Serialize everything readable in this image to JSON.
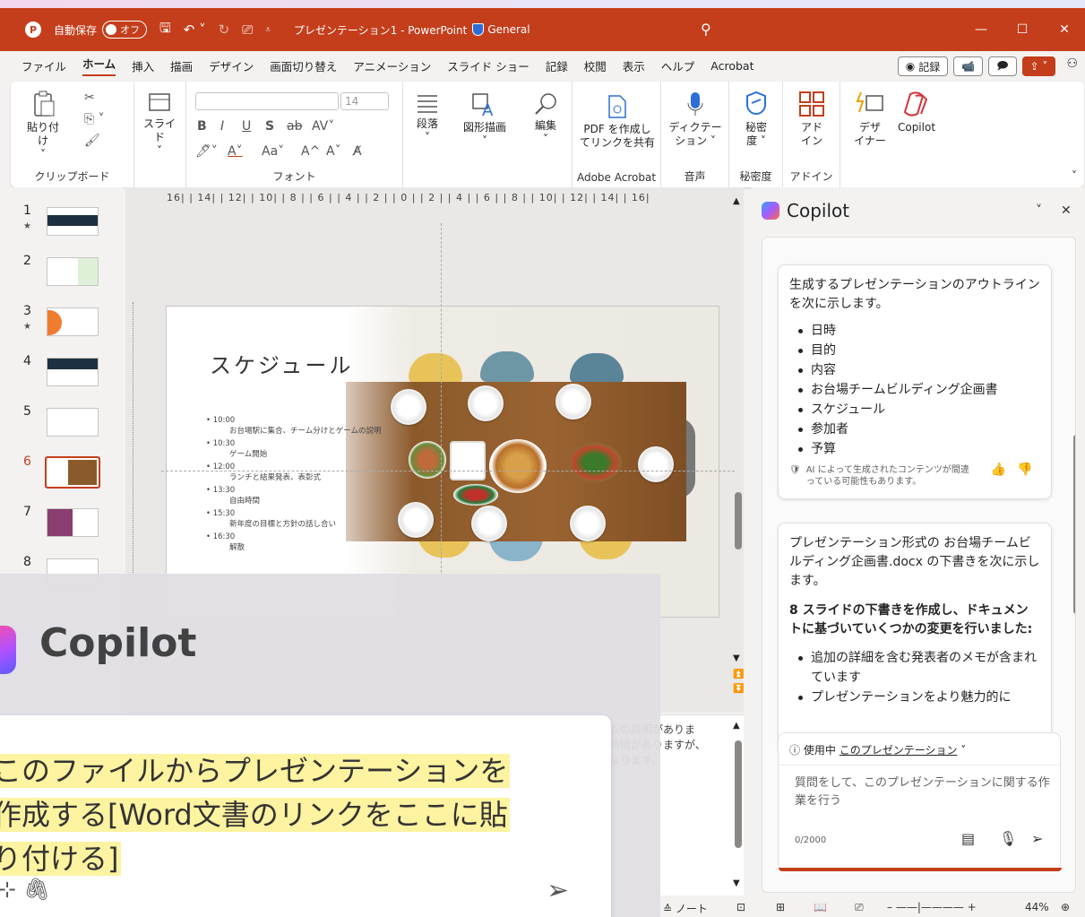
{
  "titlebar": {
    "autosave_label": "自動保存",
    "autosave_state": "オフ",
    "doc_title": "プレゼンテーション1 - PowerPoint",
    "sensitivity": "General",
    "minimize": "—",
    "maximize": "☐",
    "close": "✕"
  },
  "tabs": [
    "ファイル",
    "ホーム",
    "挿入",
    "描画",
    "デザイン",
    "画面切り替え",
    "アニメーション",
    "スライド ショー",
    "記録",
    "校閲",
    "表示",
    "ヘルプ",
    "Acrobat"
  ],
  "tabs_right": {
    "record": "記録"
  },
  "ribbon": {
    "paste": "貼り付け",
    "clipboard": "クリップボード",
    "slide": "スライド",
    "font_size": "14",
    "font_group": "フォント",
    "paragraph": "段落",
    "shapes": "図形描画",
    "edit": "編集",
    "pdf_line1": "PDF を作成し",
    "pdf_line2": "てリンクを共有",
    "adobe_group": "Adobe Acrobat",
    "dictate_line1": "ディクテー",
    "dictate_line2": "ション",
    "voice_group": "音声",
    "sens_line1": "秘密",
    "sens_line2": "度",
    "sens_group": "秘密度",
    "addin_line1": "アド",
    "addin_line2": "イン",
    "addin_group": "アドイン",
    "designer_line1": "デザ",
    "designer_line2": "イナー",
    "copilot": "Copilot"
  },
  "thumbs": [
    "1",
    "2",
    "3",
    "4",
    "5",
    "6",
    "7",
    "8"
  ],
  "ruler_text": "16| | 14| | 12| | 10| | 8 | | 6 | | 4 | | 2 | | 0 | | 2 | | 4 | | 6 | | 8 | | 10| | 12| | 14| | 16|",
  "slide": {
    "title": "スケジュール",
    "schedule": [
      {
        "time": "10:00",
        "desc": "お台場駅に集合、チーム分けとゲームの説明"
      },
      {
        "time": "10:30",
        "desc": "ゲーム開始"
      },
      {
        "time": "12:00",
        "desc": "ランチと結果発表、表彰式"
      },
      {
        "time": "13:30",
        "desc": "自由時間"
      },
      {
        "time": "15:30",
        "desc": "新年度の目標と方針の話し合い"
      },
      {
        "time": "16:30",
        "desc": "解散"
      }
    ]
  },
  "notes": {
    "line1": "ムの説明がありま",
    "line2": "時間がありますが、",
    "line3": "なります。"
  },
  "copilot": {
    "title": "Copilot",
    "card1": {
      "intro": "生成するプレゼンテーションのアウトラインを次に示します。",
      "items": [
        "日時",
        "目的",
        "内容",
        "お台場チームビルディング企画書",
        "スケジュール",
        "参加者",
        "予算"
      ],
      "disclaimer": "AI によって生成されたコンテンツが間違っている可能性もあります。"
    },
    "card2": {
      "intro": "プレゼンテーション形式の お台場チームビルディング企画書.docx の下書きを次に示します。",
      "bold": "8 スライドの下書きを作成し、ドキュメントに基づいていくつかの変更を行いました:",
      "items": [
        "追加の詳細を含む発表者のメモが含まれています",
        "プレゼンテーションをより魅力的に"
      ]
    },
    "context_prefix": "使用中",
    "context_link": "このプレゼンテーション",
    "placeholder": "質問をして、このプレゼンテーションに関する作業を行う",
    "count": "0/2000"
  },
  "status": {
    "notes": "ノート",
    "zoom": "44%"
  },
  "overlay": {
    "title": "Copilot",
    "line1": "このファイルからプレゼンテーションを",
    "line2": "作成する[Word文書のリンクをここに貼",
    "line3": "り付ける]"
  }
}
